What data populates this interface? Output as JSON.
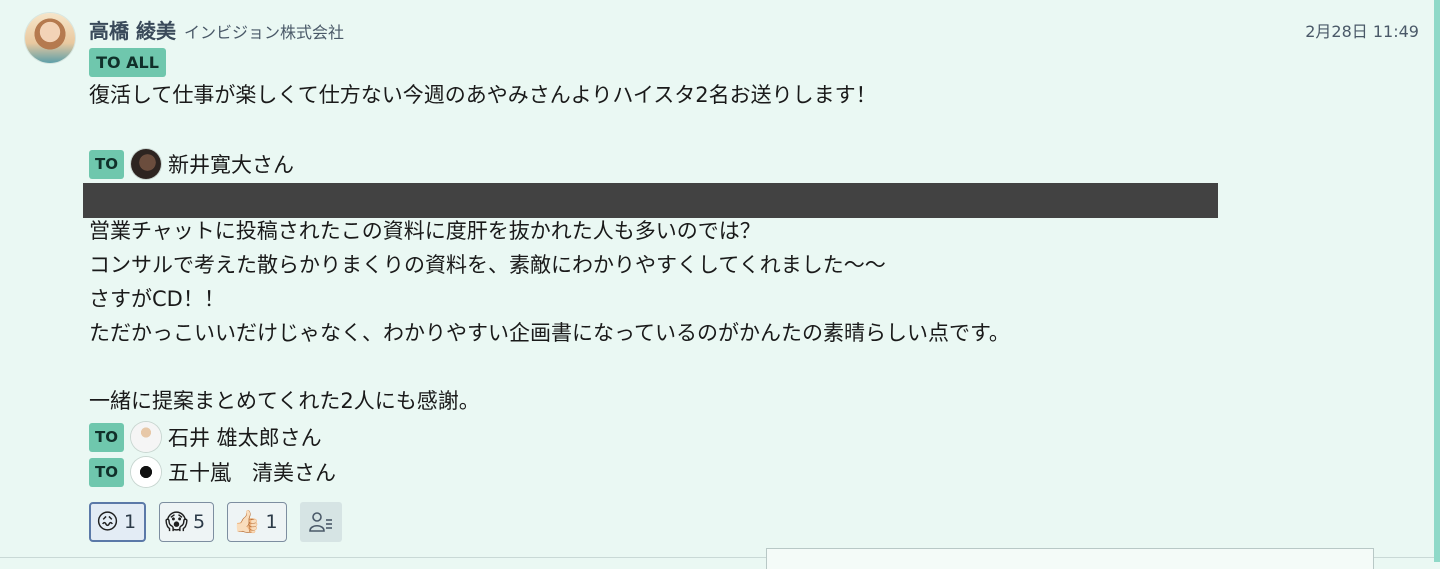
{
  "message": {
    "sender": "高橋 綾美",
    "company": "インビジョン株式会社",
    "time": "2月28日 11:49",
    "to_all_tag": "TO ALL",
    "to_tag": "TO",
    "line1": "復活して仕事が楽しくて仕方ない今週のあやみさんよりハイスタ2名お送りします！",
    "recipient1": "新井寛大さん",
    "body_lines": [
      "営業チャットに投稿されたこの資料に度肝を抜かれた人も多いのでは？",
      "コンサルで考えた散らかりまくりの資料を、素敵にわかりやすくしてくれました〜〜",
      "さすがCD！！",
      "ただかっこいいだけじゃなく、わかりやすい企画書になっているのがかんたの素晴らしい点です。"
    ],
    "thanks_line": "一緒に提案まとめてくれた2人にも感謝。",
    "recipient2": "石井 雄太郎さん",
    "recipient3": "五十嵐　清美さん"
  },
  "reactions": [
    {
      "emoji": "😖",
      "count": "1",
      "active": true
    },
    {
      "emoji": "😱",
      "count": "5",
      "active": false
    },
    {
      "emoji": "👍🏻",
      "count": "1",
      "active": false
    }
  ],
  "colors": {
    "background": "#eaf8f3",
    "tag": "#6fc7ad",
    "accent": "#8fd9c8",
    "redaction": "#424242"
  }
}
